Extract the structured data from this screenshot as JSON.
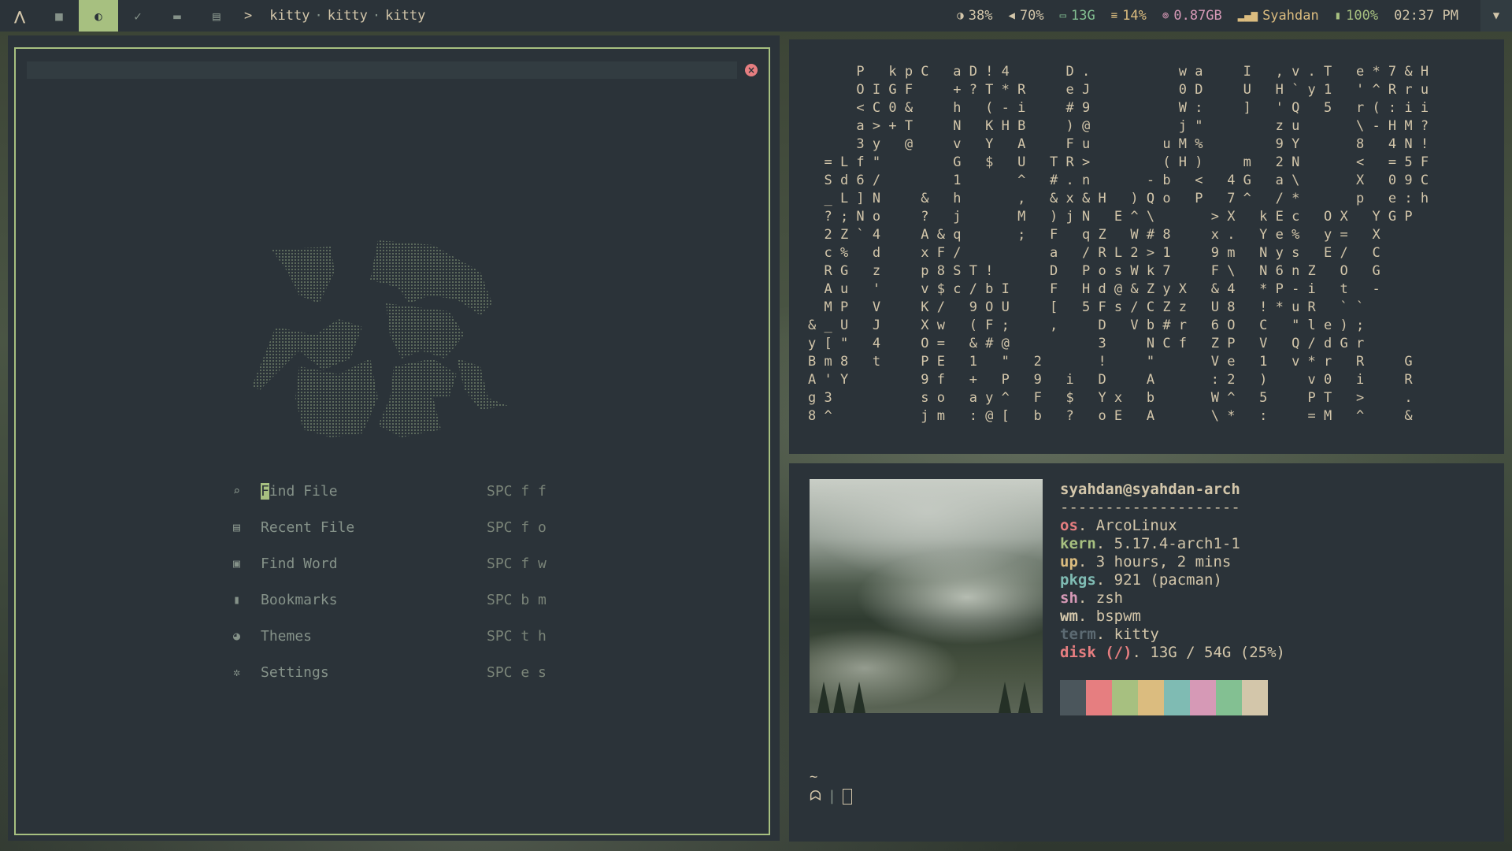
{
  "topbar": {
    "workspaces": [
      {
        "icon": "arch-logo-icon",
        "glyph": "⋀"
      },
      {
        "icon": "square-icon",
        "glyph": "■"
      },
      {
        "icon": "circle-half-icon",
        "glyph": "◐"
      },
      {
        "icon": "check-icon",
        "glyph": "✓"
      },
      {
        "icon": "folder-icon",
        "glyph": "▬"
      },
      {
        "icon": "file-icon",
        "glyph": "▤"
      }
    ],
    "active_workspace": 2,
    "prompt_symbol": ">",
    "window_title": [
      "kitty",
      "kitty",
      "kitty"
    ],
    "title_separator": "·",
    "modules": [
      {
        "icon": "brightness-icon",
        "glyph": "◑",
        "value": "38%",
        "color": "#d3c6aa"
      },
      {
        "icon": "volume-icon",
        "glyph": "◀",
        "value": "70%",
        "color": "#d3c6aa"
      },
      {
        "icon": "disk-icon",
        "glyph": "▭",
        "value": "13G",
        "color": "#83c092"
      },
      {
        "icon": "cpu-icon",
        "glyph": "≡",
        "value": "14%",
        "color": "#dbbc7f"
      },
      {
        "icon": "memory-icon",
        "glyph": "⊚",
        "value": "0.87GB",
        "color": "#d699b6"
      },
      {
        "icon": "network-icon",
        "glyph": "▂▄▆",
        "value": "Syahdan",
        "color": "#dbbc7f"
      },
      {
        "icon": "battery-icon",
        "glyph": "▮",
        "value": "100%",
        "color": "#a7c080"
      }
    ],
    "clock": "02:37 PM",
    "tray_icon": "chevron-down-icon",
    "tray_glyph": "▼"
  },
  "dashboard": {
    "close_glyph": "×",
    "menu": [
      {
        "icon": "search-icon",
        "glyph": "⌕",
        "label_first": "F",
        "label_rest": "ind File",
        "key": "SPC f f"
      },
      {
        "icon": "recent-file-icon",
        "glyph": "▤",
        "label_first": "",
        "label_rest": "Recent File",
        "key": "SPC f o"
      },
      {
        "icon": "word-icon",
        "glyph": "▣",
        "label_first": "",
        "label_rest": "Find Word",
        "key": "SPC f w"
      },
      {
        "icon": "bookmark-icon",
        "glyph": "▮",
        "label_first": "",
        "label_rest": "Bookmarks",
        "key": "SPC b m"
      },
      {
        "icon": "palette-icon",
        "glyph": "◕",
        "label_first": "",
        "label_rest": "Themes",
        "key": "SPC t h"
      },
      {
        "icon": "gear-icon",
        "glyph": "✲",
        "label_first": "",
        "label_rest": "Settings",
        "key": "SPC e s"
      }
    ]
  },
  "matrix": {
    "lines": [
      "      P   k p C   a D ! 4       D .           w a     I   , v . T   e * 7 & H",
      "      O I G F     + ? T * R     e J           0 D     U   H ` y 1   ' ^ R r u",
      "      < C 0 &     h   ( - i     # 9           W :     ]   ' Q   5   r ( : i i",
      "      a > + T     N   K H B     ) @           j \"         z u       \\ - H M ?",
      "      3 y   @     v   Y   A     F u         u M %         9 Y       8   4 N !",
      "  = L f \"         G   $   U   T R >         ( H )     m   2 N       <   = 5 F",
      "  S d 6 /         1       ^   # . n       - b   <   4 G   a \\       X   0 9 C",
      "  _ L ] N     &   h       ,   & x & H   ) Q o   P   7 ^   / *       p   e : h",
      "  ? ; N o     ?   j       M   ) j N   E ^ \\       > X   k E c   O X   Y G P",
      "  2 Z ` 4     A & q       ;   F   q Z   W # 8     x .   Y e %   y =   X",
      "  c %   d     x F /           a   / R L 2 > 1     9 m   N y s   E /   C",
      "  R G   z     p 8 S T !       D   P o s W k 7     F \\   N 6 n Z   O   G",
      "  A u   '     v $ c / b I     F   H d @ & Z y X   & 4   * P - i   t   -",
      "  M P   V     K /   9 O U     [   5 F s / C Z z   U 8   ! * u R   ` `",
      "& _ U   J     X w   ( F ;     ,     D   V b # r   6 O   C   \" l e ) ;",
      "y [ \"   4     O =   & # @           3     N C f   Z P   V   Q / d G r",
      "B m 8   t     P E   1   \"   2       !     \"       V e   1   v * r   R     G",
      "A ' Y         9 f   +   P   9   i   D     A       : 2   )     v 0   i     R",
      "g 3           s o   a y ^   F   $   Y x   b       W ^   5     P T   >     .",
      "8 ^           j m   : @ [   b   ?   o E   A       \\ *   :     = M   ^     &"
    ]
  },
  "fetch": {
    "user_host": "syahdan@syahdan-arch",
    "divider": "--------------------",
    "rows": [
      {
        "key": "os",
        "value": "ArcoLinux",
        "color": "#e67e80"
      },
      {
        "key": "kern",
        "value": "5.17.4-arch1-1",
        "color": "#a7c080"
      },
      {
        "key": "up",
        "value": "3 hours, 2 mins",
        "color": "#dbbc7f"
      },
      {
        "key": "pkgs",
        "value": "921 (pacman)",
        "color": "#7fbbb3"
      },
      {
        "key": "sh",
        "value": "zsh",
        "color": "#d699b6"
      },
      {
        "key": "wm",
        "value": "bspwm",
        "color": "#d3c6aa"
      },
      {
        "key": "term",
        "value": "kitty",
        "color": "#5c6a72"
      },
      {
        "key": "disk (/)",
        "value": "13G / 54G (25%)",
        "color": "#e67e80"
      }
    ],
    "palette": [
      "#4b565c",
      "#e67e80",
      "#a7c080",
      "#dbbc7f",
      "#7fbbb3",
      "#d699b6",
      "#83c092",
      "#d3c6aa"
    ]
  },
  "terminal": {
    "tilde": "~",
    "prompt_icon": "ghost-icon",
    "prompt_glyph": "ᗣ",
    "pipe": "|"
  }
}
